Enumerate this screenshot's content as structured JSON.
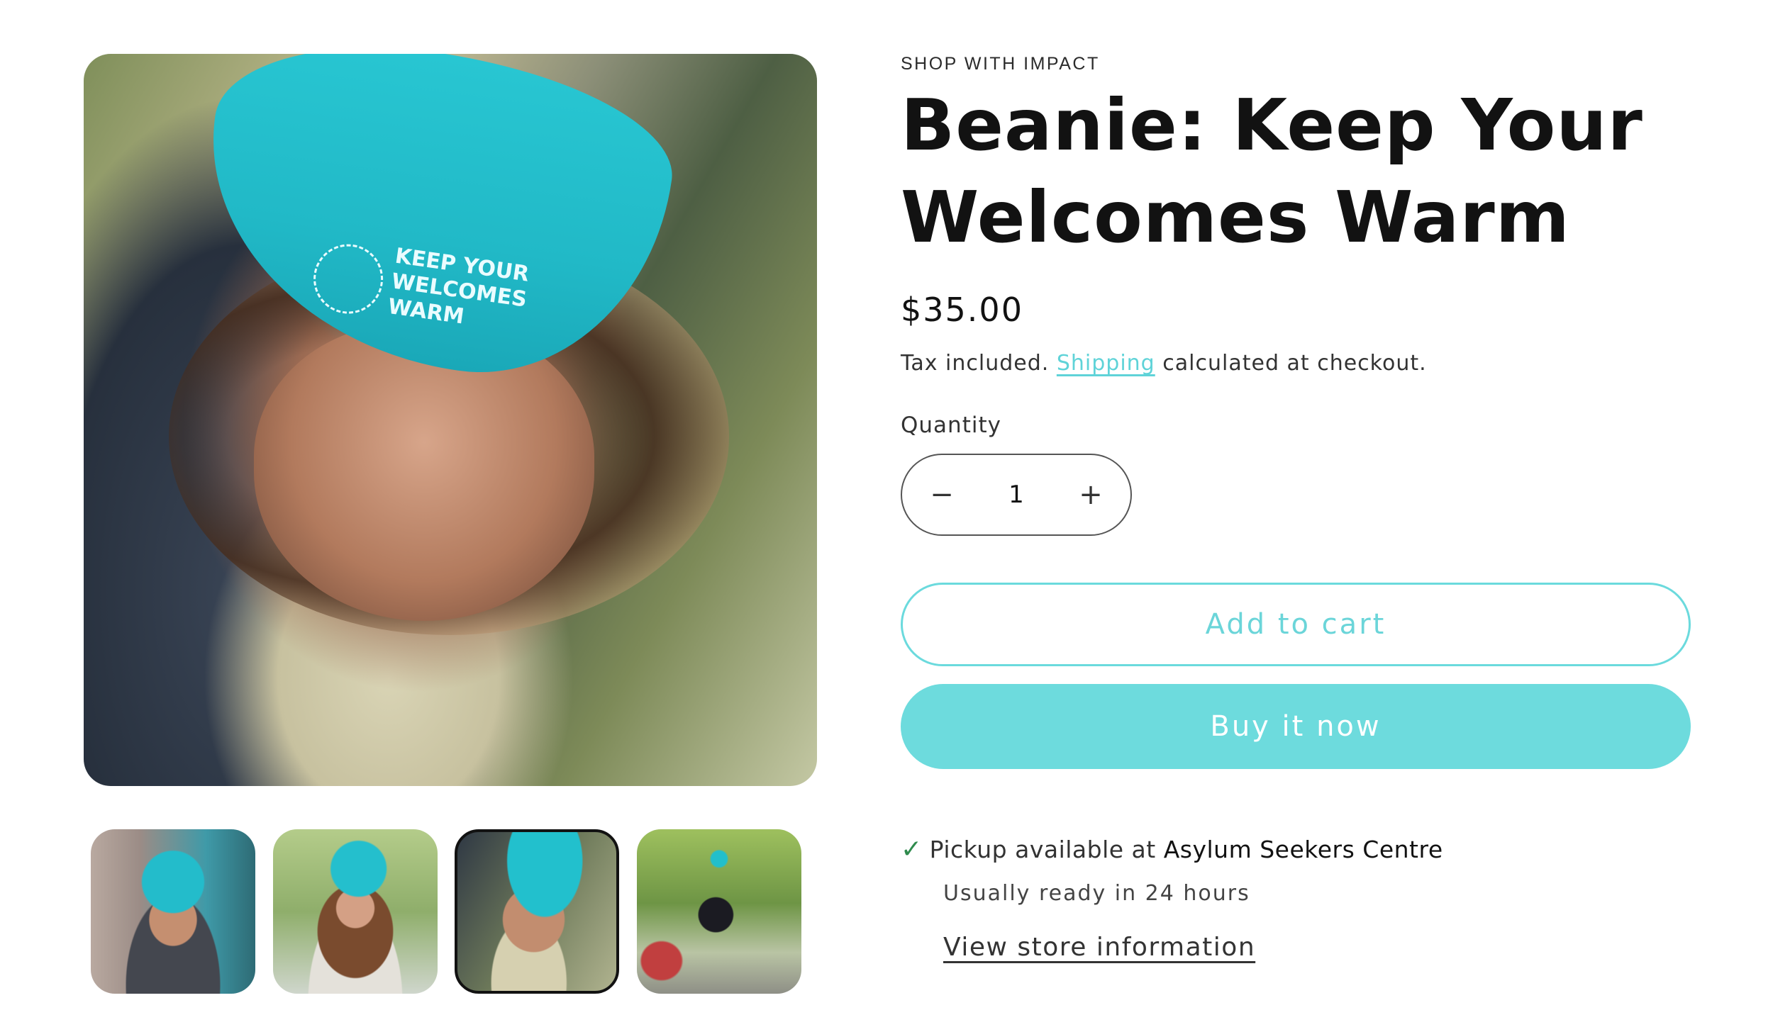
{
  "product": {
    "eyebrow": "SHOP WITH IMPACT",
    "title": "Beanie: Keep Your Welcomes Warm",
    "price": "$35.00",
    "tax_prefix": "Tax included.",
    "shipping_link": "Shipping",
    "tax_suffix": "calculated at checkout."
  },
  "media": {
    "main_image_alt": "Man wearing teal beanie looking down",
    "hat_text_line1": "KEEP YOUR",
    "hat_text_line2": "WELCOMES",
    "hat_text_line3": "WARM",
    "thumbnails": [
      {
        "alt": "Man in teal beanie smiling against mural"
      },
      {
        "alt": "Woman in teal beanie holding cup"
      },
      {
        "alt": "Man in teal beanie looking down"
      },
      {
        "alt": "Person in teal beanie on street"
      }
    ],
    "active_thumbnail": 3
  },
  "quantity": {
    "label": "Quantity",
    "value": "1",
    "minus": "−",
    "plus": "+"
  },
  "actions": {
    "add_to_cart": "Add to cart",
    "buy_now": "Buy it now"
  },
  "pickup": {
    "check": "✓",
    "prefix": "Pickup available at",
    "store": "Asylum Seekers Centre",
    "ready": "Usually ready in 24 hours",
    "store_link": "View store information"
  },
  "colors": {
    "accent": "#6ddbdd",
    "check": "#2f8b4d",
    "text": "#121212"
  }
}
